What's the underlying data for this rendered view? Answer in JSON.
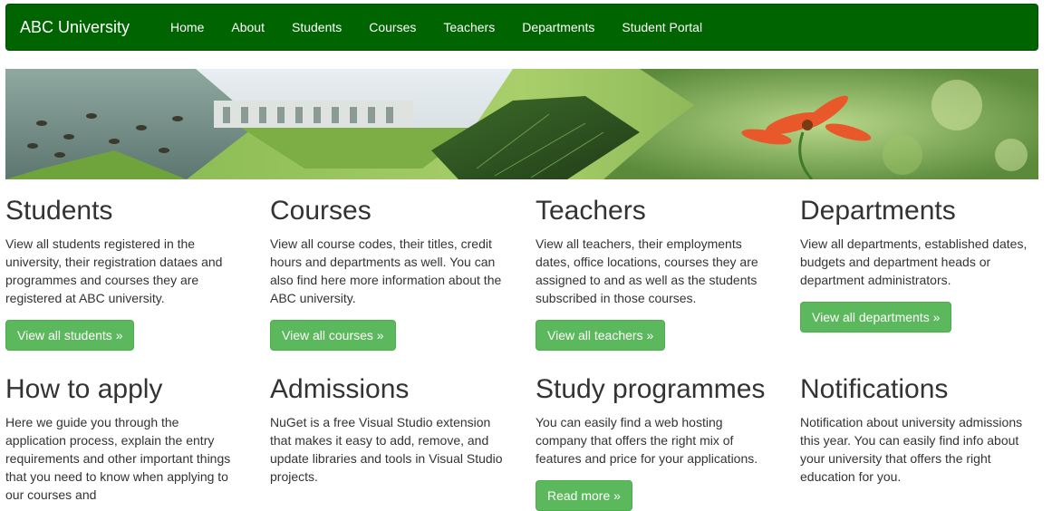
{
  "navbar": {
    "brand": "ABC University",
    "links": [
      "Home",
      "About",
      "Students",
      "Courses",
      "Teachers",
      "Departments",
      "Student Portal"
    ]
  },
  "colors": {
    "navbar_bg": "#006400",
    "button_bg": "#5cb85c",
    "text": "#333333"
  },
  "row1": [
    {
      "title": "Students",
      "text": "View all students registered in the university, their registration dataes and programmes and courses they are registered at ABC university.",
      "button": "View all students »"
    },
    {
      "title": "Courses",
      "text": "View all course codes, their titles, credit hours and departments as well. You can also find here more information about the ABC university.",
      "button": "View all courses »"
    },
    {
      "title": "Teachers",
      "text": "View all teachers, their employments dates, office locations, courses they are assigned to and as well as the students subscribed in those courses.",
      "button": "View all teachers »"
    },
    {
      "title": "Departments",
      "text": "View all departments, established dates, budgets and department heads or department administrators.",
      "button": "View all departments »"
    }
  ],
  "row2": [
    {
      "title": "How to apply",
      "text": "Here we guide you through the application process, explain the entry requirements and other important things that you need to know when applying to our courses and"
    },
    {
      "title": "Admissions",
      "text": "NuGet is a free Visual Studio extension that makes it easy to add, remove, and update libraries and tools in Visual Studio projects."
    },
    {
      "title": "Study programmes",
      "text": "You can easily find a web hosting company that offers the right mix of features and price for your applications.",
      "button": "Read more »"
    },
    {
      "title": "Notifications",
      "text": "Notification about university admissions this year. You can easily find info about your university that offers the right education for you."
    }
  ]
}
